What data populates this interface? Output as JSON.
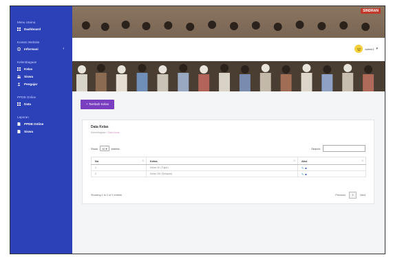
{
  "sidebar": {
    "sections": [
      {
        "heading": "Menu Utama",
        "items": [
          {
            "label": "Dashboard",
            "icon": "dashboard-icon"
          }
        ]
      },
      {
        "heading": "Konten Website",
        "items": [
          {
            "label": "Informasi",
            "icon": "info-icon",
            "chevron": "›"
          }
        ]
      },
      {
        "heading": "Kelembagaan",
        "items": [
          {
            "label": "Kelas",
            "icon": "grid-icon"
          },
          {
            "label": "Siswa",
            "icon": "users-icon"
          },
          {
            "label": "Pengajar",
            "icon": "teacher-icon"
          }
        ]
      },
      {
        "heading": "PPDB Online",
        "items": [
          {
            "label": "Data",
            "icon": "grid-icon"
          }
        ]
      },
      {
        "heading": "Laporan",
        "items": [
          {
            "label": "PPDB Online",
            "icon": "file-icon"
          },
          {
            "label": "Siswa",
            "icon": "file-icon"
          }
        ]
      }
    ]
  },
  "header": {
    "brand": "SINDRAN",
    "user_name": "admin1",
    "caret": "▾"
  },
  "toolbar": {
    "add_label": "+ Tambah Kelas"
  },
  "card": {
    "title": "Data Kelas",
    "breadcrumb_home": "Kelembagaan",
    "breadcrumb_sep": "/",
    "breadcrumb_active": "Data Kelas",
    "show_label": "Show",
    "show_value": "10",
    "entries_label": "entries",
    "search_label": "Search:"
  },
  "table": {
    "columns": [
      "No",
      "Kelas",
      "Aksi"
    ],
    "rows": [
      {
        "no": "1",
        "kelas": "Kelas VII (Tujuh)"
      },
      {
        "no": "2",
        "kelas": "Kelas VIII (Delapan)"
      }
    ]
  },
  "footer": {
    "info": "Showing 1 to 2 of 2 entries",
    "previous": "Previous",
    "page": "1",
    "next": "Next"
  },
  "colors": {
    "sidebar": "#2c41b8",
    "add_button": "#7a3fc1",
    "edit_icon": "#2a8cd6",
    "delete_icon": "#3d50c5"
  }
}
